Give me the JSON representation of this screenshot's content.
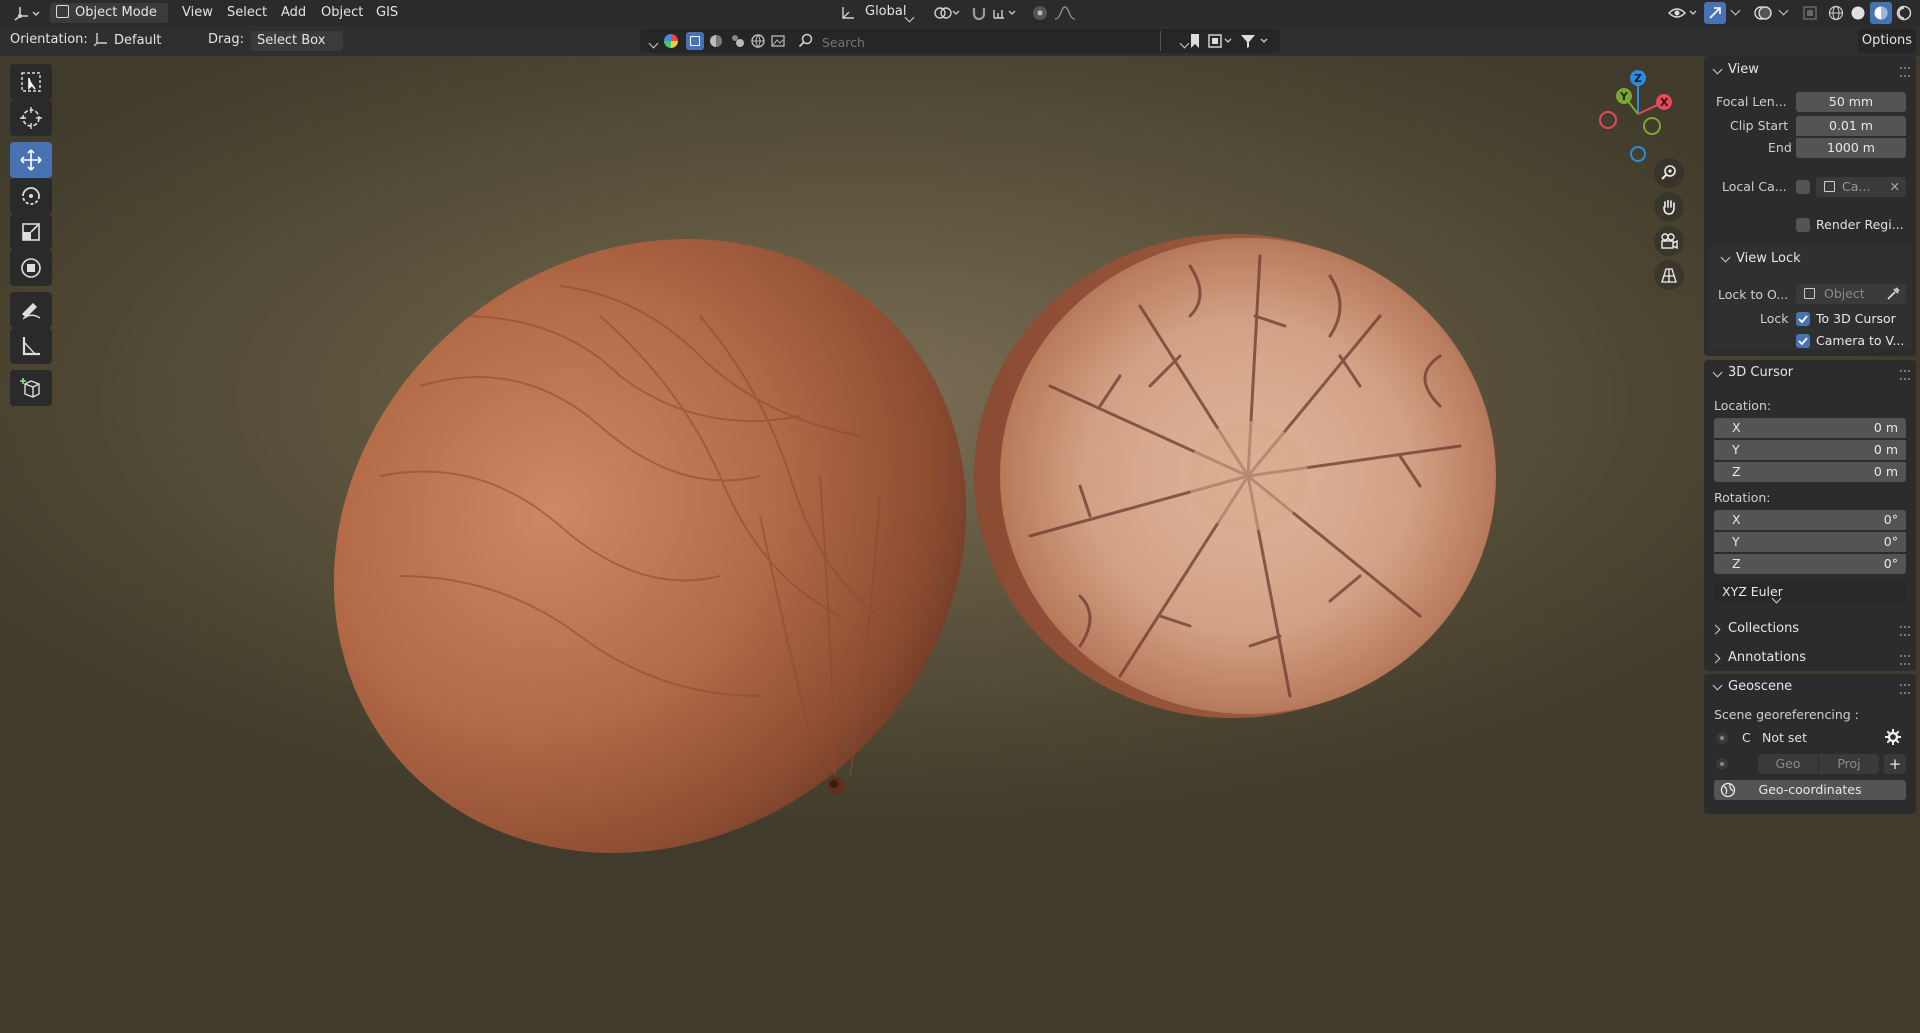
{
  "header": {
    "mode": "Object Mode",
    "menus": [
      "View",
      "Select",
      "Add",
      "Object",
      "GIS"
    ],
    "transform_orientation": "Global"
  },
  "tool_header": {
    "orientation_label": "Orientation:",
    "orientation_value": "Default",
    "drag_label": "Drag:",
    "drag_value": "Select Box",
    "search_placeholder": "Search",
    "options_label": "Options"
  },
  "gizmo": {
    "z": "Z",
    "y": "Y",
    "x": "X"
  },
  "colors": {
    "accent": "#4772b3",
    "axis_x": "#e54a59",
    "axis_y": "#7aa832",
    "axis_z": "#2b8cdf",
    "panel_bg": "#2c2c2c",
    "field_bg": "#545454"
  },
  "panel": {
    "view": {
      "title": "View",
      "focal_label": "Focal Len...",
      "focal_value": "50 mm",
      "clip_start_label": "Clip Start",
      "clip_start_value": "0.01 m",
      "clip_end_label": "End",
      "clip_end_value": "1000 m",
      "local_camera_label": "Local Ca...",
      "local_camera_value": "Ca...",
      "render_region_label": "Render Regi...",
      "view_lock": {
        "title": "View Lock",
        "lock_obj_label": "Lock to O...",
        "lock_obj_placeholder": "Object",
        "lock_label": "Lock",
        "to_cursor": "To 3D Cursor",
        "camera_to_view": "Camera to V..."
      }
    },
    "cursor": {
      "title": "3D Cursor",
      "location_label": "Location:",
      "loc": [
        {
          "axis": "X",
          "value": "0 m"
        },
        {
          "axis": "Y",
          "value": "0 m"
        },
        {
          "axis": "Z",
          "value": "0 m"
        }
      ],
      "rotation_label": "Rotation:",
      "rot": [
        {
          "axis": "X",
          "value": "0°"
        },
        {
          "axis": "Y",
          "value": "0°"
        },
        {
          "axis": "Z",
          "value": "0°"
        }
      ],
      "rotation_mode": "XYZ Euler"
    },
    "collections": {
      "title": "Collections"
    },
    "annotations": {
      "title": "Annotations"
    },
    "geoscene": {
      "title": "Geoscene",
      "georef_label": "Scene georeferencing :",
      "c_label": "C",
      "not_set": "Not set",
      "geo": "Geo",
      "proj": "Proj",
      "geo_coordinates": "Geo-coordinates"
    }
  }
}
